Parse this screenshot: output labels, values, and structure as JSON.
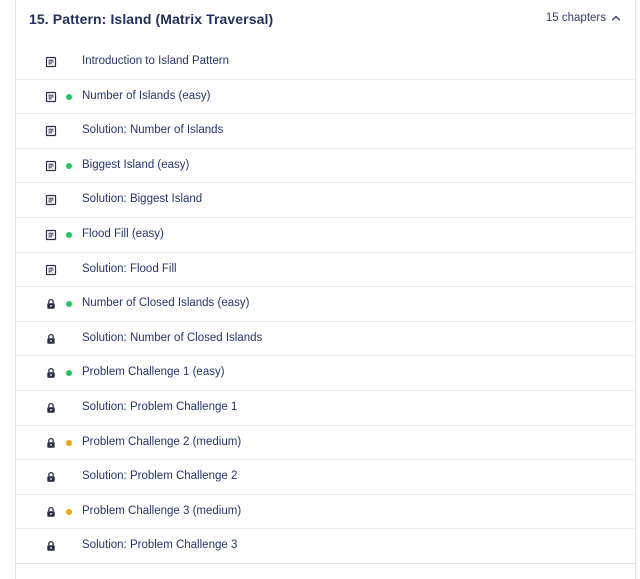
{
  "section": {
    "title": "15.  Pattern: Island (Matrix Traversal)",
    "chapter_count": "15 chapters",
    "collapse_icon": "chevron-up-icon"
  },
  "colors": {
    "easy": "#22c55e",
    "medium": "#f0a30a",
    "icon": "#2a2f45"
  },
  "chapters": [
    {
      "label": "Introduction to Island Pattern",
      "icon": "document-icon",
      "difficulty": ""
    },
    {
      "label": "Number of Islands (easy)",
      "icon": "document-icon",
      "difficulty": "easy"
    },
    {
      "label": "Solution: Number of Islands",
      "icon": "document-icon",
      "difficulty": ""
    },
    {
      "label": "Biggest Island (easy)",
      "icon": "document-icon",
      "difficulty": "easy"
    },
    {
      "label": "Solution: Biggest Island",
      "icon": "document-icon",
      "difficulty": ""
    },
    {
      "label": "Flood Fill (easy)",
      "icon": "document-icon",
      "difficulty": "easy"
    },
    {
      "label": "Solution: Flood Fill",
      "icon": "document-icon",
      "difficulty": ""
    },
    {
      "label": "Number of Closed Islands (easy)",
      "icon": "lock-icon",
      "difficulty": "easy"
    },
    {
      "label": "Solution: Number of Closed Islands",
      "icon": "lock-icon",
      "difficulty": ""
    },
    {
      "label": "Problem Challenge 1 (easy)",
      "icon": "lock-icon",
      "difficulty": "easy"
    },
    {
      "label": "Solution: Problem Challenge 1",
      "icon": "lock-icon",
      "difficulty": ""
    },
    {
      "label": "Problem Challenge 2 (medium)",
      "icon": "lock-icon",
      "difficulty": "medium"
    },
    {
      "label": "Solution: Problem Challenge 2",
      "icon": "lock-icon",
      "difficulty": ""
    },
    {
      "label": "Problem Challenge 3 (medium)",
      "icon": "lock-icon",
      "difficulty": "medium"
    },
    {
      "label": "Solution: Problem Challenge 3",
      "icon": "lock-icon",
      "difficulty": ""
    }
  ]
}
